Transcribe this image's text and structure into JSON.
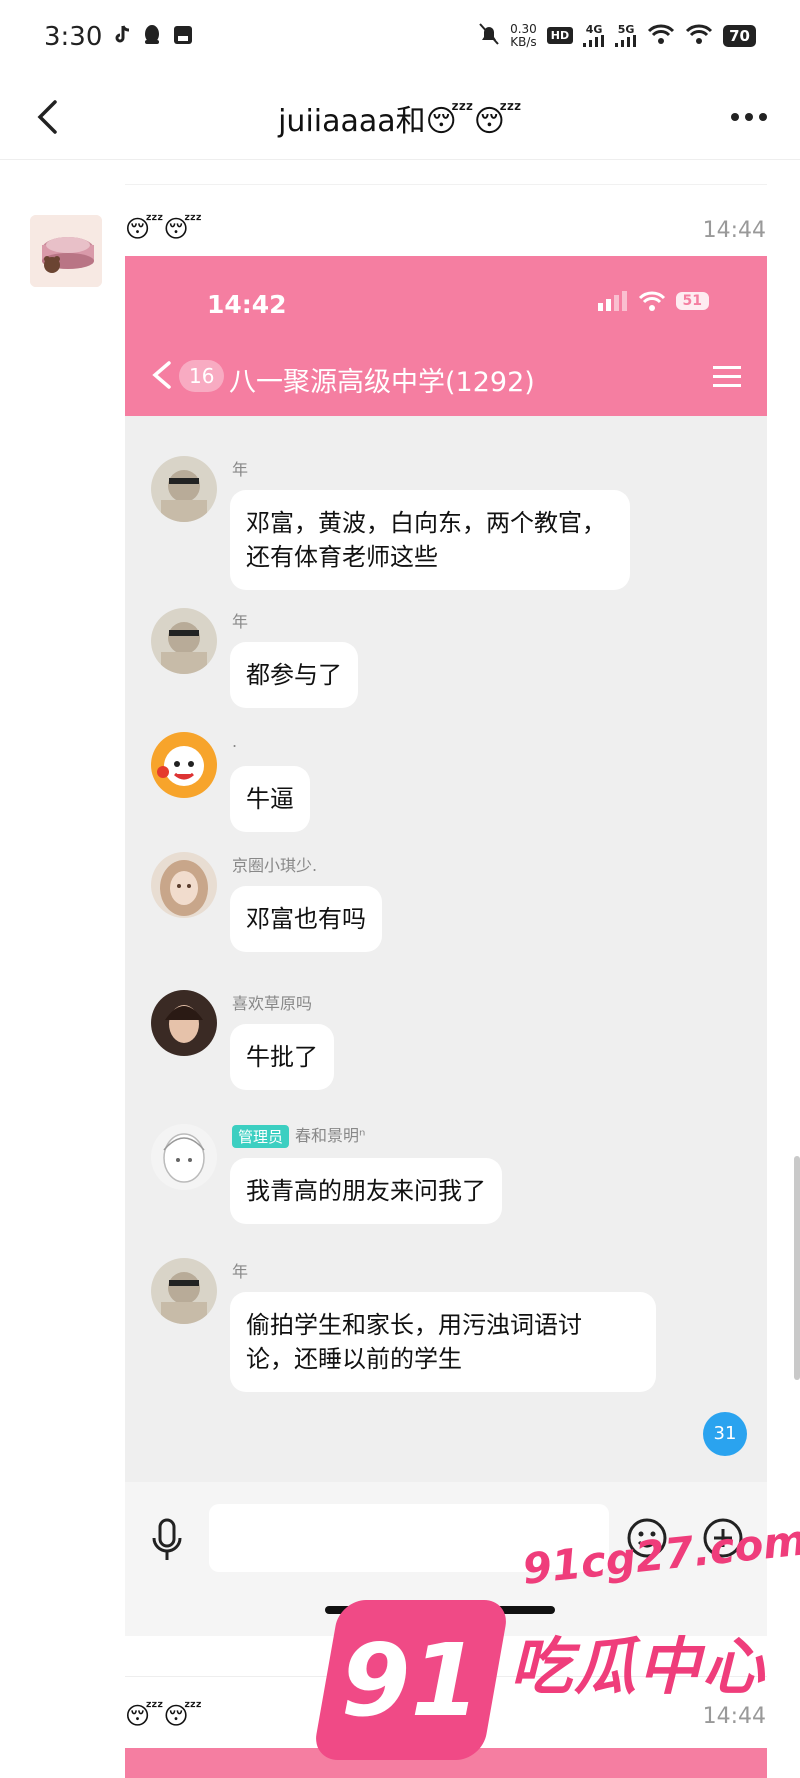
{
  "status_bar": {
    "time": "3:30",
    "net_speed_value": "0.30",
    "net_speed_unit": "KB/s",
    "hd_label": "HD",
    "net_4g": "4G",
    "net_5g": "5G",
    "battery": "70"
  },
  "header": {
    "title": "juiiaaaa和😴😴"
  },
  "messages": [
    {
      "sender": "😴😴",
      "time": "14:44",
      "screenshot": {
        "time": "14:42",
        "battery": "51",
        "back_badge": "16",
        "group_title": "八一聚源高级中学(1292)",
        "chat": [
          {
            "name": "年",
            "text": "邓富，黄波，白向东，两个教官，\n还有体育老师这些",
            "admin": ""
          },
          {
            "name": "年",
            "text": "都参与了",
            "admin": ""
          },
          {
            "name": ".",
            "text": "牛逼",
            "admin": ""
          },
          {
            "name": "京圈小琪少.",
            "text": "邓富也有吗",
            "admin": ""
          },
          {
            "name": "喜欢草原吗",
            "text": "牛批了",
            "admin": ""
          },
          {
            "name": "春和景明ⁿ",
            "text": "我青高的朋友来问我了",
            "admin": "管理员"
          },
          {
            "name": "年",
            "text": "偷拍学生和家长，用污浊词语讨\n论，还睡以前的学生",
            "admin": ""
          }
        ],
        "unread_count": "31"
      }
    },
    {
      "sender": "😴😴",
      "time": "14:44"
    }
  ],
  "watermark": {
    "url": "91cg27.com",
    "logo": "91",
    "name": "吃瓜中心"
  },
  "colors": {
    "accent_pink": "#f57ea1",
    "admin_teal": "#3ccfc1",
    "badge_blue": "#2aa3ef"
  }
}
